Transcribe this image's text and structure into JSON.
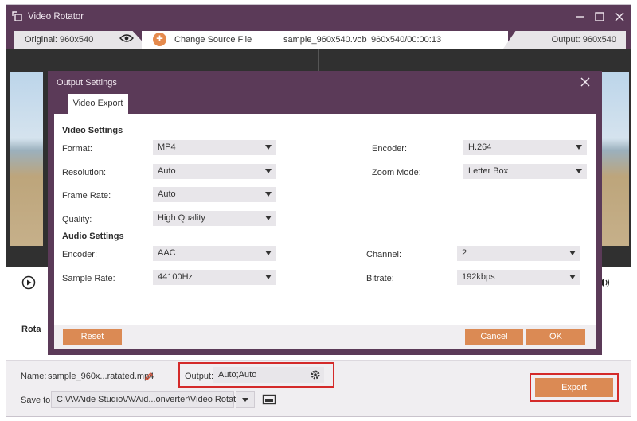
{
  "window": {
    "title": "Video Rotator",
    "controls": [
      "minimize-icon",
      "maximize-icon",
      "close-icon"
    ]
  },
  "infobar": {
    "original": "Original: 960x540",
    "change_source": "Change Source File",
    "file_name": "sample_960x540.vob",
    "file_dims": "960x540/00:00:13",
    "output": "Output: 960x540"
  },
  "rotation": {
    "label": "Rota"
  },
  "bottom": {
    "name_label": "Name:",
    "name_value": "sample_960x...ratated.mp4",
    "output_label": "Output:",
    "output_value": "Auto;Auto",
    "save_label": "Save to:",
    "save_path": "C:\\AVAide Studio\\AVAid...onverter\\Video Rotator",
    "export": "Export"
  },
  "modal": {
    "title": "Output Settings",
    "tab": "Video Export",
    "video_heading": "Video Settings",
    "audio_heading": "Audio Settings",
    "video": {
      "format_label": "Format:",
      "format_value": "MP4",
      "resolution_label": "Resolution:",
      "resolution_value": "Auto",
      "framerate_label": "Frame Rate:",
      "framerate_value": "Auto",
      "quality_label": "Quality:",
      "quality_value": "High Quality",
      "encoder_label": "Encoder:",
      "encoder_value": "H.264",
      "zoom_label": "Zoom Mode:",
      "zoom_value": "Letter Box"
    },
    "audio": {
      "encoder_label": "Encoder:",
      "encoder_value": "AAC",
      "samplerate_label": "Sample Rate:",
      "samplerate_value": "44100Hz",
      "channel_label": "Channel:",
      "channel_value": "2",
      "bitrate_label": "Bitrate:",
      "bitrate_value": "192kbps"
    },
    "reset": "Reset",
    "cancel": "Cancel",
    "ok": "OK"
  },
  "colors": {
    "chrome": "#5b3a58",
    "accent": "#db8a54",
    "highlight": "#d42a2a"
  }
}
